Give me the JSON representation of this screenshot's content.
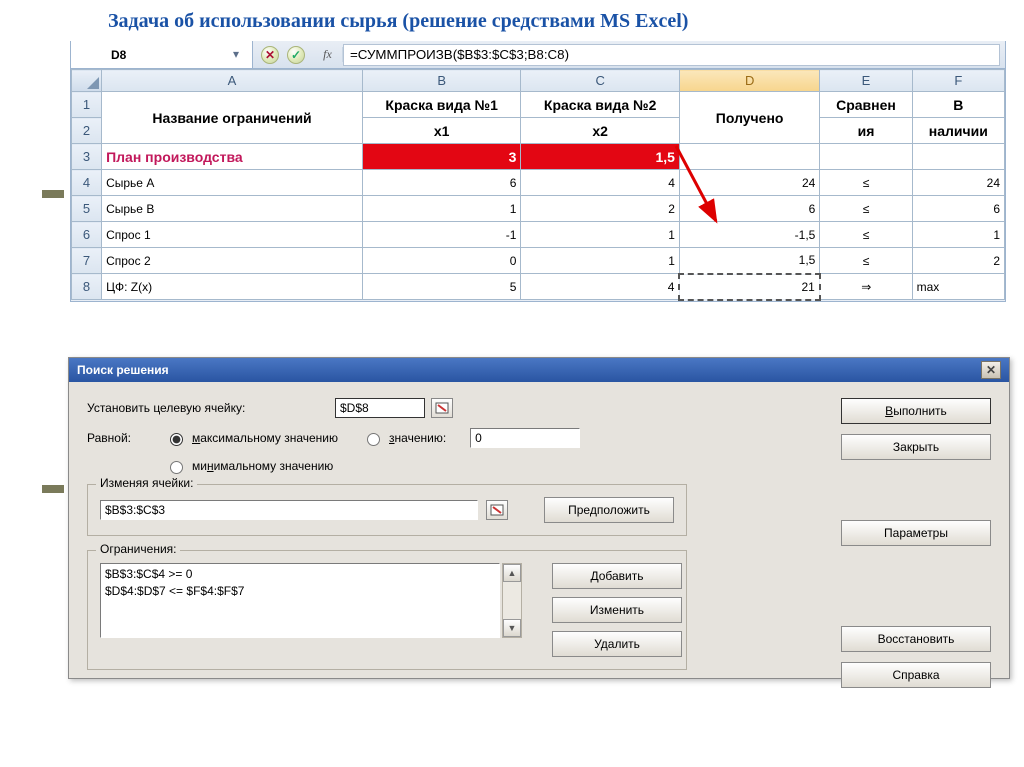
{
  "title": "Задача об использовании сырья (решение средствами MS Excel)",
  "namebox": {
    "cell": "D8"
  },
  "formula_bar": {
    "fx": "fx",
    "formula": "=СУММПРОИЗВ($B$3:$C$3;B8:C8)"
  },
  "columns": [
    "A",
    "B",
    "C",
    "D",
    "E",
    "F"
  ],
  "header_rows": {
    "r1": {
      "A": "Название ограничений",
      "B": "Краска вида №1",
      "C": "Краска вида №2",
      "D": "Получено",
      "E": "Сравнен",
      "F": "В"
    },
    "r2": {
      "B": "x1",
      "C": "x2",
      "E": "ия",
      "F": "наличии"
    }
  },
  "rows": [
    {
      "n": "3",
      "A": "План производства",
      "B": "3",
      "C": "1,5",
      "D": "",
      "E": "",
      "F": "",
      "red": true
    },
    {
      "n": "4",
      "A": "Сырье А",
      "B": "6",
      "C": "4",
      "D": "24",
      "E": "≤",
      "F": "24"
    },
    {
      "n": "5",
      "A": "Сырье В",
      "B": "1",
      "C": "2",
      "D": "6",
      "E": "≤",
      "F": "6"
    },
    {
      "n": "6",
      "A": "Спрос 1",
      "B": "-1",
      "C": "1",
      "D": "-1,5",
      "E": "≤",
      "F": "1"
    },
    {
      "n": "7",
      "A": "Спрос 2",
      "B": "0",
      "C": "1",
      "D": "1,5",
      "E": "≤",
      "F": "2"
    },
    {
      "n": "8",
      "A": "ЦФ: Z(x)",
      "B": "5",
      "C": "4",
      "D": "21",
      "E": "⇒",
      "F": "max"
    }
  ],
  "solver": {
    "title": "Поиск решения",
    "target_label": "Установить целевую ячейку:",
    "target_value": "$D$8",
    "equal_label": "Равной:",
    "opt_max": "максимальному значению",
    "opt_min": "минимальному значению",
    "opt_val_label": "значению:",
    "opt_val_value": "0",
    "changing_legend": "Изменяя ячейки:",
    "changing_value": "$B$3:$C$3",
    "constraints_legend": "Ограничения:",
    "constraints": [
      "$B$3:$C$4 >= 0",
      "$D$4:$D$7 <= $F$4:$F$7"
    ],
    "btn_run": "Выполнить",
    "btn_close": "Закрыть",
    "btn_guess": "Предположить",
    "btn_options": "Параметры",
    "btn_add": "Добавить",
    "btn_change": "Изменить",
    "btn_delete": "Удалить",
    "btn_reset": "Восстановить",
    "btn_help": "Справка"
  }
}
